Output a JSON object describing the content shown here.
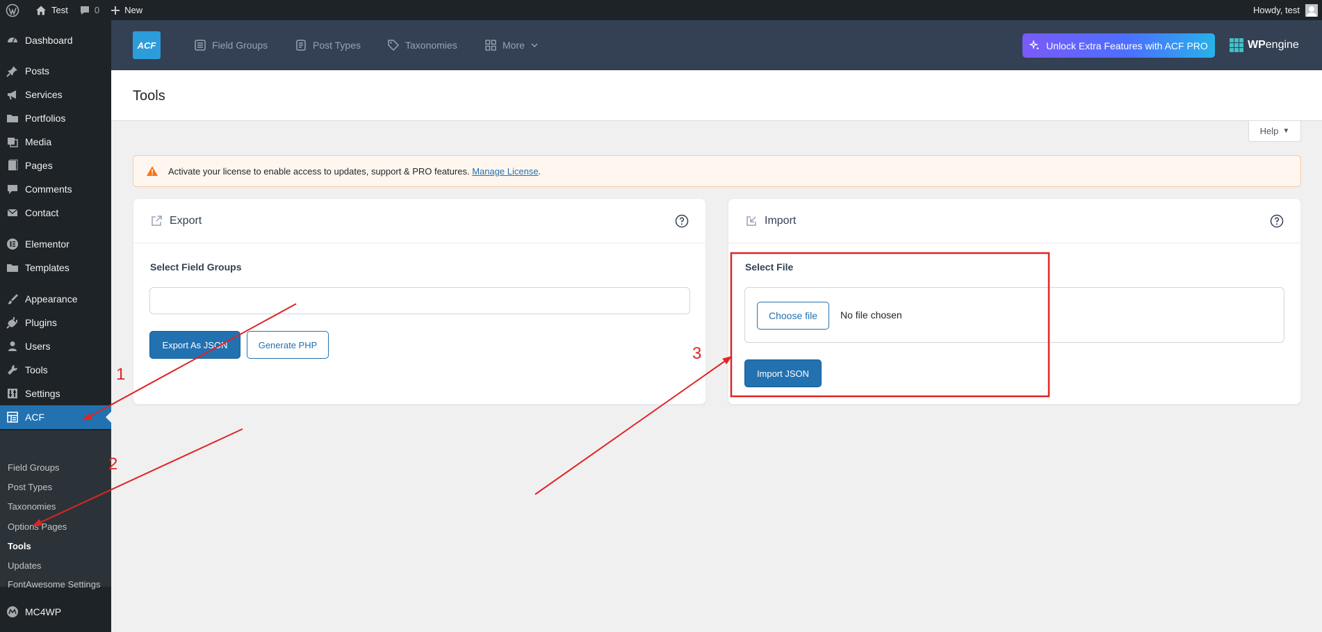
{
  "admin_bar": {
    "site_name": "Test",
    "comments_count": "0",
    "new_label": "New",
    "howdy": "Howdy, test"
  },
  "sidebar": {
    "items": [
      {
        "label": "Dashboard",
        "icon": "dashboard-icon"
      },
      {
        "label": "Posts",
        "icon": "pin-icon"
      },
      {
        "label": "Services",
        "icon": "megaphone-icon"
      },
      {
        "label": "Portfolios",
        "icon": "folder-icon"
      },
      {
        "label": "Media",
        "icon": "media-icon"
      },
      {
        "label": "Pages",
        "icon": "page-icon"
      },
      {
        "label": "Comments",
        "icon": "comment-icon"
      },
      {
        "label": "Contact",
        "icon": "mail-icon"
      },
      {
        "label": "Elementor",
        "icon": "elementor-icon"
      },
      {
        "label": "Templates",
        "icon": "folder-icon"
      },
      {
        "label": "Appearance",
        "icon": "brush-icon"
      },
      {
        "label": "Plugins",
        "icon": "plugin-icon"
      },
      {
        "label": "Users",
        "icon": "user-icon"
      },
      {
        "label": "Tools",
        "icon": "wrench-icon"
      },
      {
        "label": "Settings",
        "icon": "settings-icon"
      },
      {
        "label": "ACF",
        "icon": "acf-icon"
      },
      {
        "label": "MC4WP",
        "icon": "mc4wp-icon"
      }
    ],
    "submenu": [
      "Field Groups",
      "Post Types",
      "Taxonomies",
      "Options Pages",
      "Tools",
      "Updates",
      "FontAwesome Settings"
    ]
  },
  "acf_header": {
    "logo_text": "ACF",
    "nav": [
      "Field Groups",
      "Post Types",
      "Taxonomies",
      "More"
    ],
    "pro_button": "Unlock Extra Features with ACF PRO",
    "wpengine_wp": "WP",
    "wpengine_engine": "engine"
  },
  "page": {
    "title": "Tools",
    "help": "Help"
  },
  "notice": {
    "text": "Activate your license to enable access to updates, support & PRO features. ",
    "link": "Manage License",
    "suffix": "."
  },
  "export_panel": {
    "title": "Export",
    "field_label": "Select Field Groups",
    "export_button": "Export As JSON",
    "php_button": "Generate PHP"
  },
  "import_panel": {
    "title": "Import",
    "field_label": "Select File",
    "choose_file": "Choose file",
    "no_file": "No file chosen",
    "import_button": "Import JSON"
  },
  "annotations": {
    "labels": [
      "1",
      "2",
      "3"
    ],
    "color": "#e02424"
  },
  "colors": {
    "admin_dark": "#1d2327",
    "wp_blue": "#2271b1",
    "acf_header": "#344054"
  }
}
